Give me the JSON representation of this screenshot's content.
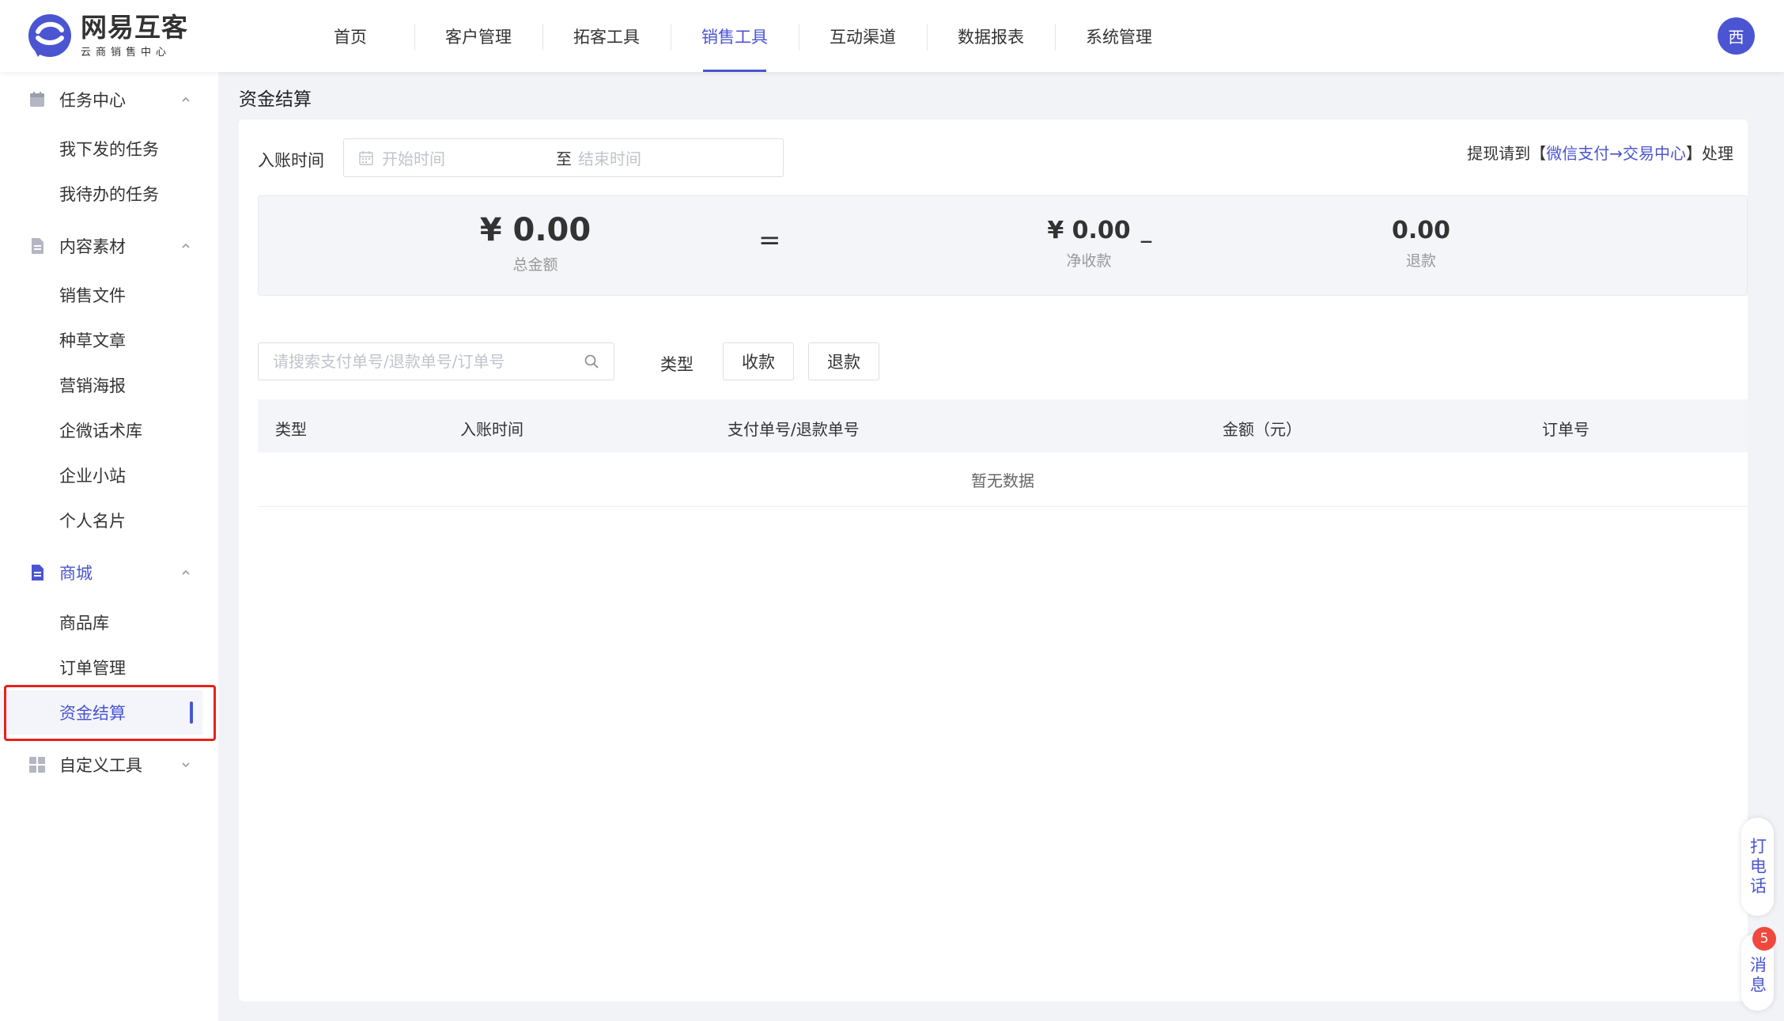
{
  "brand": {
    "title": "网易互客",
    "subtitle": "云商销售中心",
    "colors": {
      "accent": "#4b55d1",
      "highlight": "#e8201d",
      "badge": "#f0483e"
    }
  },
  "nav": {
    "items": [
      "首页",
      "客户管理",
      "拓客工具",
      "销售工具",
      "互动渠道",
      "数据报表",
      "系统管理"
    ],
    "active": "销售工具"
  },
  "user": {
    "avatar_text": "西"
  },
  "sidebar": {
    "groups": [
      {
        "label": "任务中心",
        "icon": "calendar-icon",
        "expanded": true,
        "items": [
          "我下发的任务",
          "我待办的任务"
        ]
      },
      {
        "label": "内容素材",
        "icon": "document-icon",
        "expanded": true,
        "items": [
          "销售文件",
          "种草文章",
          "营销海报",
          "企微话术库",
          "企业小站",
          "个人名片"
        ]
      },
      {
        "label": "商城",
        "icon": "shop-doc-icon",
        "expanded": true,
        "items": [
          "商品库",
          "订单管理",
          "资金结算"
        ]
      },
      {
        "label": "自定义工具",
        "icon": "grid-icon",
        "expanded": false,
        "items": []
      }
    ],
    "active_item": "资金结算"
  },
  "page": {
    "title": "资金结算"
  },
  "filter": {
    "label": "入账时间",
    "start_placeholder": "开始时间",
    "separator": "至",
    "end_placeholder": "结束时间",
    "note_prefix": "提现请到【",
    "note_link": "微信支付→交易中心",
    "note_suffix": "】处理"
  },
  "summary": {
    "total": {
      "value": "¥ 0.00",
      "label": "总金额"
    },
    "op_equals": "=",
    "net": {
      "value": "¥ 0.00",
      "label": "净收款"
    },
    "op_minus": "–",
    "refund": {
      "value": "0.00",
      "label": "退款"
    }
  },
  "search": {
    "placeholder": "请搜索支付单号/退款单号/订单号"
  },
  "type_filter": {
    "label": "类型",
    "options": [
      "收款",
      "退款"
    ]
  },
  "table": {
    "columns": [
      "类型",
      "入账时间",
      "支付单号/退款单号",
      "金额（元）",
      "订单号"
    ],
    "empty_text": "暂无数据"
  },
  "floating": {
    "call": "打电话",
    "message": "消息",
    "message_badge": "5"
  }
}
